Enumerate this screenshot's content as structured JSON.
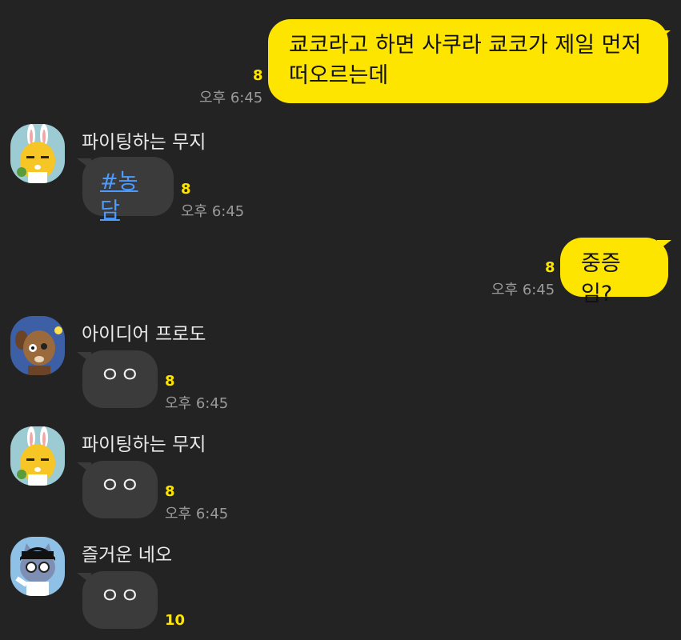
{
  "messages": [
    {
      "type": "out",
      "text": "쿄코라고 하면 사쿠라 쿄코가 제일 먼저 떠오르는데",
      "unread": "8",
      "time": "오후 6:45"
    },
    {
      "type": "in",
      "sender": "파이팅하는 무지",
      "avatar": "muzi-rabbit-avatar",
      "text": "#농담",
      "unread": "8",
      "time": "오후 6:45"
    },
    {
      "type": "out",
      "text": "중증임?",
      "unread": "8",
      "time": "오후 6:45"
    },
    {
      "type": "in",
      "sender": "아이디어 프로도",
      "avatar": "frodo-dog-avatar",
      "text": "ㅇㅇ",
      "unread": "8",
      "time": "오후 6:45"
    },
    {
      "type": "in",
      "sender": "파이팅하는 무지",
      "avatar": "muzi-rabbit-avatar",
      "text": "ㅇㅇ",
      "unread": "8",
      "time": "오후 6:45"
    },
    {
      "type": "in",
      "sender": "즐거운 네오",
      "avatar": "neo-cat-avatar",
      "text": "ㅇㅇ",
      "unread": "10",
      "time": ""
    }
  ],
  "colors": {
    "background": "#232323",
    "out_bubble": "#fee500",
    "in_bubble": "#3b3b3b",
    "unread": "#fee500",
    "hashtag": "#4d9bff"
  }
}
